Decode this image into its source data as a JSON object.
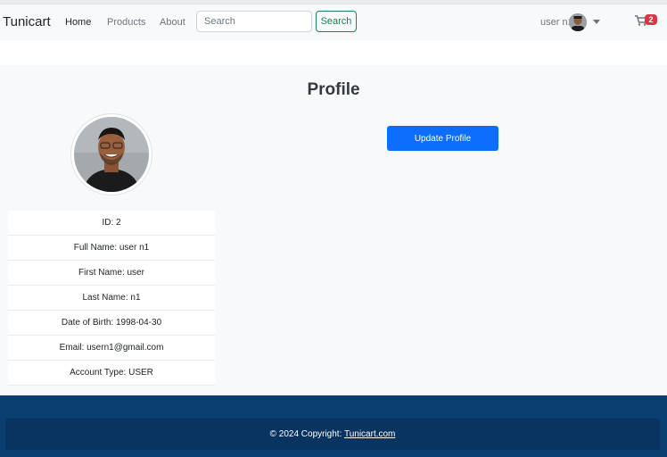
{
  "nav": {
    "brand": "Tunicart",
    "links": [
      "Home",
      "Products",
      "About"
    ],
    "search_placeholder": "Search",
    "search_button": "Search",
    "user_name": "user n1",
    "cart_icon": "cart-icon",
    "cart_count": "2"
  },
  "profile": {
    "title": "Profile",
    "update_button": "Update Profile",
    "fields": [
      "ID: 2",
      "Full Name: user n1",
      "First Name: user",
      "Last Name: n1",
      "Date of Birth: 1998-04-30",
      "Email: usern1@gmail.com",
      "Account Type: USER"
    ]
  },
  "footer": {
    "copyright_prefix": "© 2024 Copyright: ",
    "link_text": "Tunicart.com"
  },
  "colors": {
    "primary": "#0d6efd",
    "success": "#198754",
    "danger": "#dc3545",
    "footer": "#0b3f72"
  }
}
